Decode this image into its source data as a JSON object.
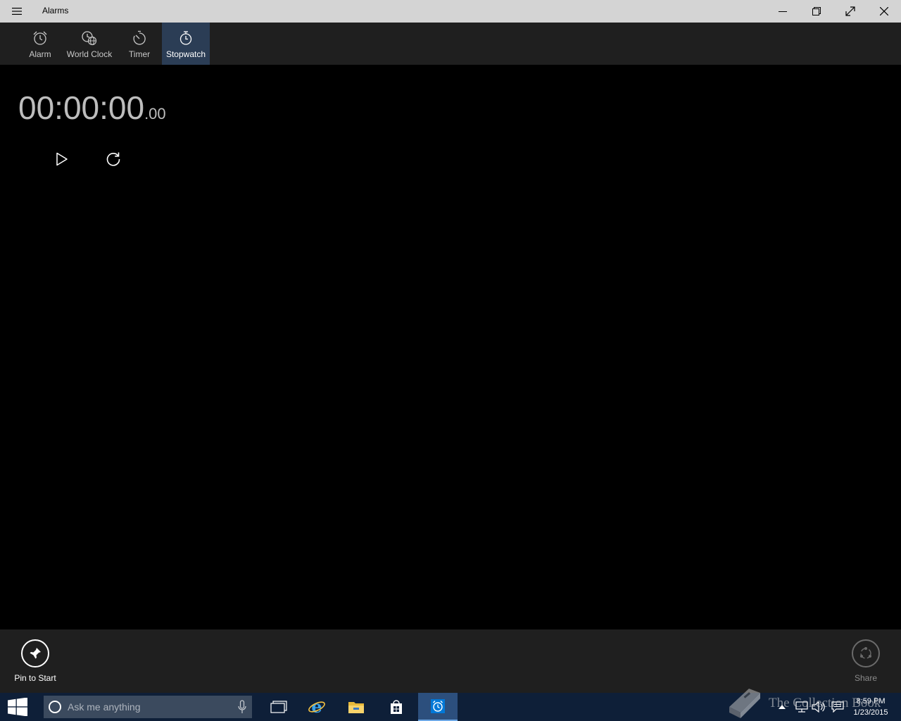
{
  "window": {
    "title": "Alarms",
    "controls": [
      "minimize-icon",
      "restore-icon",
      "fullscreen-icon",
      "close-icon"
    ]
  },
  "tabs": [
    {
      "label": "Alarm",
      "icon": "alarm-clock-icon",
      "active": false
    },
    {
      "label": "World Clock",
      "icon": "world-clock-icon",
      "active": false
    },
    {
      "label": "Timer",
      "icon": "timer-icon",
      "active": false
    },
    {
      "label": "Stopwatch",
      "icon": "stopwatch-icon",
      "active": true
    }
  ],
  "stopwatch": {
    "time_main": "00:00:00",
    "time_fraction": ".00",
    "controls": [
      "play-icon",
      "reset-icon"
    ]
  },
  "appbar": {
    "pin_label": "Pin to Start",
    "share_label": "Share"
  },
  "taskbar": {
    "search_placeholder": "Ask me anything",
    "clock_time": "8:59 PM",
    "clock_date": "1/23/2015",
    "pinned": [
      "task-view-icon",
      "internet-explorer-icon",
      "file-explorer-icon",
      "store-icon",
      "alarms-app-icon"
    ]
  },
  "watermark": {
    "text": "The Collection Book"
  },
  "colors": {
    "titlebar": "#d4d4d4",
    "tabbar": "#1f1f1f",
    "active_tab": "#2b3d55",
    "taskbar": "#0e1f38",
    "accent": "#0078d7"
  }
}
